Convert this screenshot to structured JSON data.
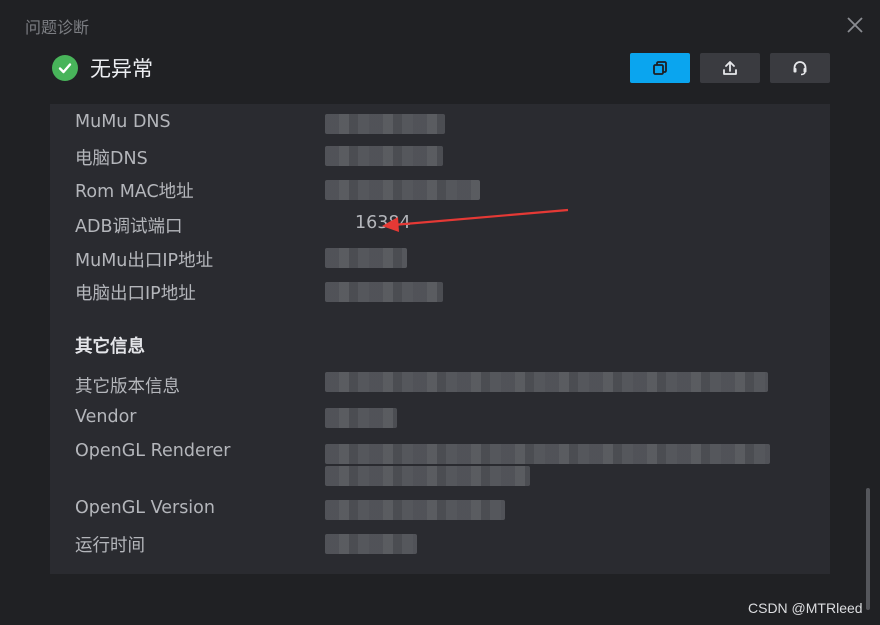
{
  "window": {
    "title": "问题诊断"
  },
  "status": {
    "text": "无异常",
    "icon": "check-circle-icon",
    "color": "#48b45a"
  },
  "toolbar": {
    "copy_icon": "copy-icon",
    "upload_icon": "upload-icon",
    "support_icon": "headset-icon",
    "accent": "#0aa5ef"
  },
  "rows": [
    {
      "label": "MuMu DNS",
      "value": null
    },
    {
      "label": "电脑DNS",
      "value": null
    },
    {
      "label": "Rom MAC地址",
      "value": null
    },
    {
      "label": "ADB调试端口",
      "value": "16384"
    },
    {
      "label": "MuMu出口IP地址",
      "value": null
    },
    {
      "label": "电脑出口IP地址",
      "value": null
    }
  ],
  "section_other": "其它信息",
  "rows2": [
    {
      "label": "其它版本信息",
      "value": null
    },
    {
      "label": "Vendor",
      "value": null
    },
    {
      "label": "OpenGL Renderer",
      "value": null
    },
    {
      "label": "OpenGL Version",
      "value": null
    },
    {
      "label": "运行时间",
      "value": null
    }
  ],
  "annotation": {
    "arrow_color": "#e53935"
  },
  "watermark": "CSDN @MTRleed"
}
